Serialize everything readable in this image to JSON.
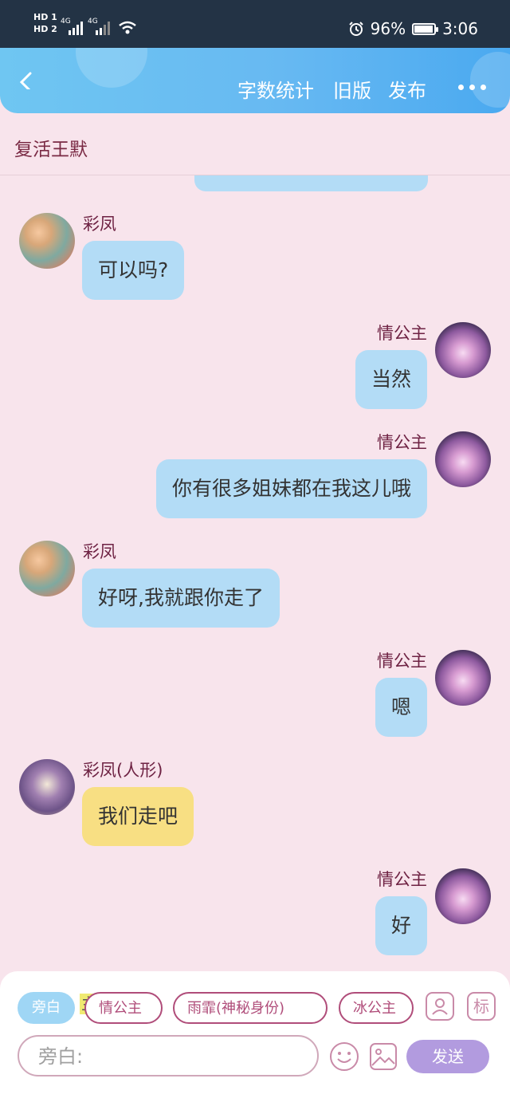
{
  "status_bar": {
    "sim1": "HD 1",
    "sim2": "HD 2",
    "net1": "4G",
    "net2": "4G",
    "battery_percent": "96%",
    "battery_level": 0.96,
    "time": "3:06"
  },
  "header": {
    "word_count": "字数统计",
    "old_version": "旧版",
    "publish": "发布"
  },
  "story_title": "复活王默",
  "messages": [
    {
      "speaker": "彩凤",
      "text": "可以吗?",
      "side": "left",
      "avatar": "caifeng-avatar"
    },
    {
      "speaker": "情公主",
      "text": "当然",
      "side": "right",
      "avatar": "princess-avatar"
    },
    {
      "speaker": "情公主",
      "text": "你有很多姐妹都在我这儿哦",
      "side": "right",
      "avatar": "princess-avatar"
    },
    {
      "speaker": "彩凤",
      "text": "好呀,我就跟你走了",
      "side": "left",
      "avatar": "caifeng-avatar"
    },
    {
      "speaker": "情公主",
      "text": "嗯",
      "side": "right",
      "avatar": "princess-avatar"
    },
    {
      "speaker": "彩凤(人形)",
      "text": "我们走吧",
      "side": "left",
      "avatar": "caifeng-human-avatar"
    },
    {
      "speaker": "情公主",
      "text": "好",
      "side": "right",
      "avatar": "princess-avatar"
    }
  ],
  "composer": {
    "narration_chip": "旁白",
    "highlight_char": "主",
    "roles": [
      "情公主",
      "雨霏(神秘身份)",
      "冰公主"
    ],
    "input_placeholder": "旁白:",
    "send_label": "发送",
    "tag_icon_label": "标"
  },
  "colors": {
    "background": "#f8e4ec",
    "bubble_blue": "#b3dcf6",
    "bubble_yellow": "#f8df83",
    "name_color": "#6e2243",
    "send_button": "#b29bdf"
  }
}
